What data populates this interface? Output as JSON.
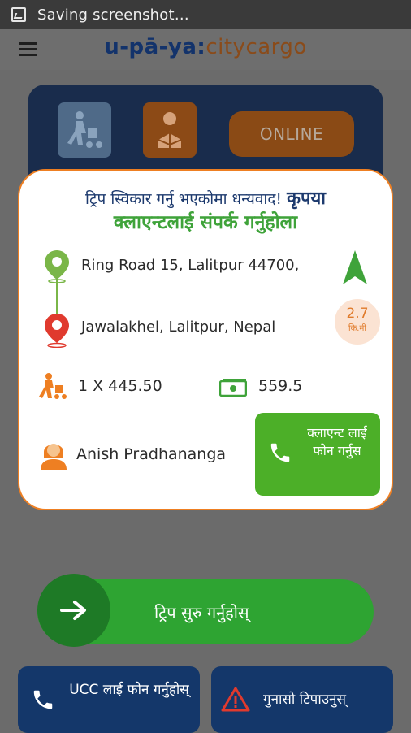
{
  "statusbar": {
    "text": "Saving screenshot…"
  },
  "header": {
    "logo_main": "u-pā-ya:",
    "logo_city": "city",
    "logo_cargo": "cargo"
  },
  "top_panel": {
    "online_label": "ONLINE"
  },
  "card": {
    "thanks_text": "ट्रिप स्विकार गर्नु भएकोमा धन्यवाद!",
    "please_text": "कृपया",
    "contact_text": "क्लाएन्टलाई संपर्क गर्नुहोला",
    "pickup_address": "Ring Road 15, Lalitpur 44700,",
    "drop_address": "Jawalakhel, Lalitpur, Nepal",
    "distance_value": "2.7",
    "distance_unit": "कि.मी",
    "load_info": "1 X 445.50",
    "fare": "559.5",
    "client_name": "Anish Pradhananga",
    "call_client_label": "क्लाएन्ट लाई फोन गर्नुस"
  },
  "swipe": {
    "label": "ट्रिप सुरु गर्नुहोस्"
  },
  "bottom": {
    "call_ucc_label": "UCC लाई फोन गर्नुहोस्",
    "complain_label": "गुनासो टिपाउनुस्"
  },
  "colors": {
    "navy": "#14376a",
    "green": "#4caf28",
    "orange": "#ee7f22"
  }
}
